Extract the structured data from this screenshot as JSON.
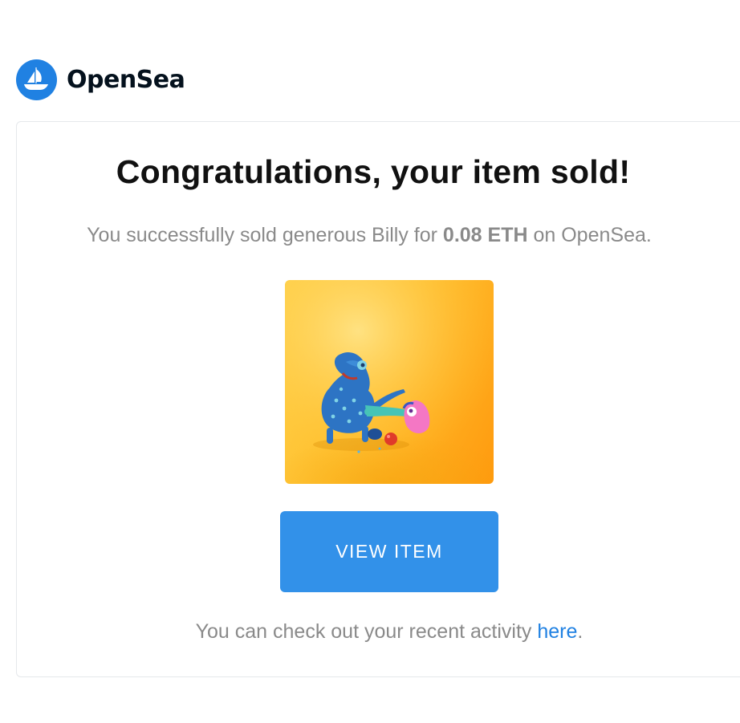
{
  "brand": {
    "name": "OpenSea",
    "logo_icon": "opensea-ship-icon",
    "color": "#2081e2"
  },
  "email": {
    "title": "Congratulations, your item sold!",
    "message": {
      "prefix": "You successfully sold generous Billy for ",
      "amount": "0.08 ETH",
      "suffix": " on OpenSea."
    },
    "item_image": "nft-artwork",
    "button_label": "VIEW ITEM",
    "footer": {
      "prefix": "You can check out your recent activity ",
      "link_text": "here",
      "suffix": "."
    }
  },
  "colors": {
    "button": "#3291e9",
    "link": "#2081e2",
    "body_text": "#8a8a8a",
    "title_text": "#111111"
  }
}
